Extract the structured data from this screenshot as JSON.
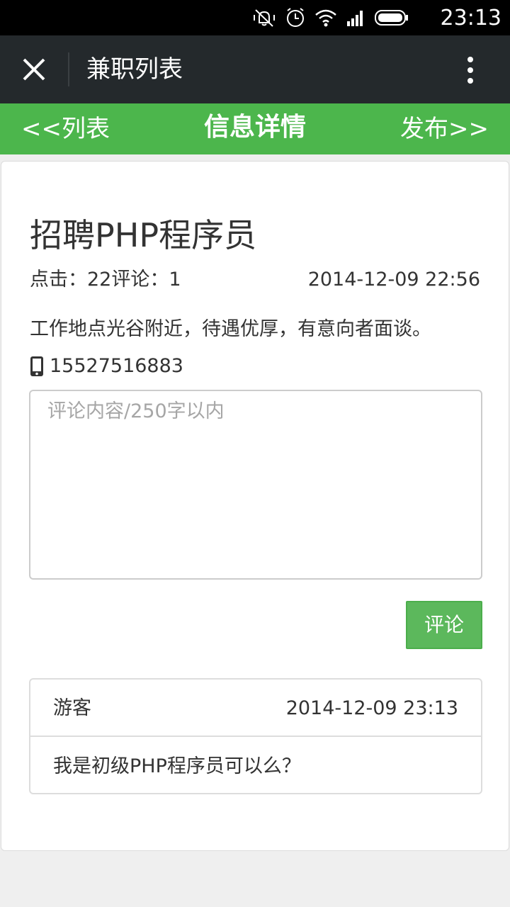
{
  "status_bar": {
    "time": "23:13",
    "icons": [
      "mute-vibrate-icon",
      "alarm-icon",
      "wifi-icon",
      "signal-icon",
      "battery-icon"
    ]
  },
  "title_bar": {
    "title": "兼职列表",
    "close_icon": "close-icon",
    "more_icon": "more-vertical-icon"
  },
  "nav": {
    "back_label": "<<列表",
    "title": "信息详情",
    "publish_label": "发布>>",
    "color": "#4cb64c"
  },
  "post": {
    "title": "招聘PHP程序员",
    "stats": "点击：22评论：1",
    "date": "2014-12-09 22:56",
    "description": "工作地点光谷附近，待遇优厚，有意向者面谈。",
    "phone": "15527516883"
  },
  "comment_form": {
    "placeholder": "评论内容/250字以内",
    "value": "",
    "submit_label": "评论",
    "submit_color": "#5cb85c"
  },
  "comments": [
    {
      "author": "游客",
      "time": "2014-12-09 23:13",
      "content": "我是初级PHP程序员可以么？"
    }
  ]
}
